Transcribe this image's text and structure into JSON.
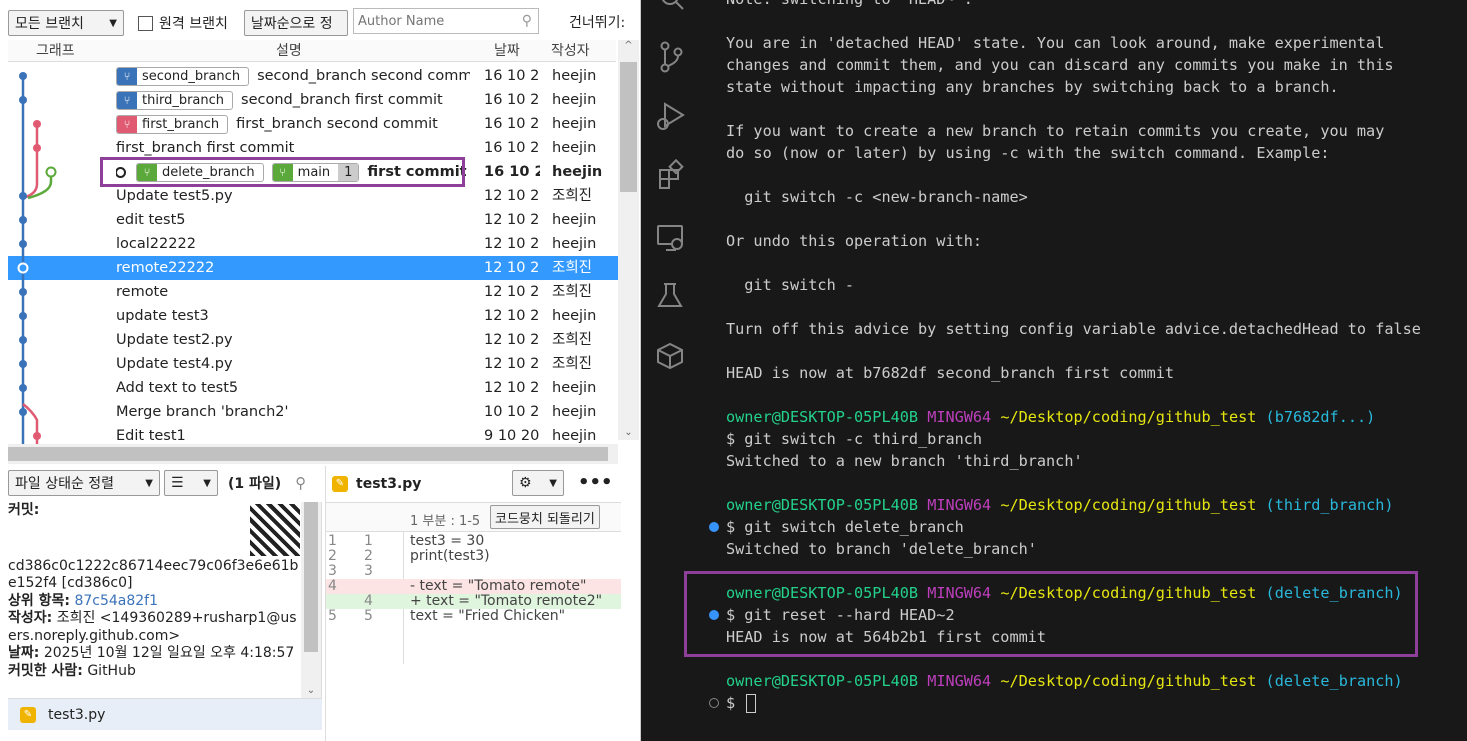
{
  "toolbar": {
    "branch_filter": "모든 브랜치",
    "remote_branch_label": "원격 브랜치",
    "sort_label": "날짜순으로 정",
    "author_placeholder": "Author Name",
    "jump_label": "건너뛰기:"
  },
  "columns": {
    "graph": "그래프",
    "description": "설명",
    "date": "날짜",
    "author": "작성자"
  },
  "commits": [
    {
      "tags": [
        "second_branch"
      ],
      "message": "second_branch second commit",
      "date": "16 10 2",
      "author": "heejin"
    },
    {
      "tags": [
        "third_branch"
      ],
      "message": "second_branch first commit",
      "date": "16 10 2",
      "author": "heejin"
    },
    {
      "tags": [
        "first_branch"
      ],
      "message": "first_branch second commit",
      "date": "16 10 2",
      "author": "heejin"
    },
    {
      "tags": [],
      "message": "first_branch first commit",
      "date": "16 10 2",
      "author": "heejin"
    },
    {
      "tags": [
        "delete_branch",
        "main"
      ],
      "badge": "1",
      "message": "first commit",
      "date": "16 10 2",
      "author": "heejin"
    },
    {
      "tags": [],
      "message": "Update test5.py",
      "date": "12 10 2",
      "author": "조희진"
    },
    {
      "tags": [],
      "message": "edit test5",
      "date": "12 10 2",
      "author": "heejin"
    },
    {
      "tags": [],
      "message": "local22222",
      "date": "12 10 2",
      "author": "heejin"
    },
    {
      "tags": [],
      "message": "remote22222",
      "date": "12 10 2",
      "author": "조희진"
    },
    {
      "tags": [],
      "message": "remote",
      "date": "12 10 2",
      "author": "조희진"
    },
    {
      "tags": [],
      "message": "update test3",
      "date": "12 10 2",
      "author": "heejin"
    },
    {
      "tags": [],
      "message": "Update test2.py",
      "date": "12 10 2",
      "author": "조희진"
    },
    {
      "tags": [],
      "message": "Update test4.py",
      "date": "12 10 2",
      "author": "조희진"
    },
    {
      "tags": [],
      "message": "Add text to test5",
      "date": "12 10 2",
      "author": "heejin"
    },
    {
      "tags": [],
      "message": "Merge branch 'branch2'",
      "date": "10 10 2",
      "author": "heejin"
    },
    {
      "tags": [],
      "message": "Edit test1",
      "date": "9 10 20",
      "author": "heejin"
    }
  ],
  "file_pane": {
    "sort_label": "파일 상태순 정렬",
    "count_label": "(1 파일)",
    "file": "test3.py"
  },
  "commit_info": {
    "commit_label": "커밋:",
    "hash": "cd386c0c1222c86714eec79c06f3e6e61be152f4 [cd386c0]",
    "parent_label": "상위 항목:",
    "parent": "87c54a82f1",
    "author_label": "작성자:",
    "author": "조희진 <149360289+rusharp1@users.noreply.github.com>",
    "date_label": "날짜:",
    "date": "2025년 10월 12일 일요일 오후 4:18:57",
    "committer_label": "커밋한 사람:",
    "committer": "GitHub"
  },
  "diff": {
    "file": "test3.py",
    "hunk_label": "1 부분 : 1-5",
    "revert_button": "코드뭉치 되돌리기",
    "lines": [
      {
        "old": "1",
        "new": "1",
        "text": "test3 = 30",
        "kind": "ctx"
      },
      {
        "old": "2",
        "new": "2",
        "text": "print(test3)",
        "kind": "ctx"
      },
      {
        "old": "3",
        "new": "3",
        "text": "",
        "kind": "ctx"
      },
      {
        "old": "4",
        "new": "",
        "text": "- text = \"Tomato remote\"",
        "kind": "del"
      },
      {
        "old": "",
        "new": "4",
        "text": "+ text = \"Tomato remote2\"",
        "kind": "add"
      },
      {
        "old": "5",
        "new": "5",
        "text": "text = \"Fried Chicken\"",
        "kind": "ctx"
      }
    ]
  },
  "terminal": {
    "lines": [
      "Note: switching to 'HEAD~'.",
      "",
      "You are in 'detached HEAD' state. You can look around, make experimental",
      "changes and commit them, and you can discard any commits you make in this",
      "state without impacting any branches by switching back to a branch.",
      "",
      "If you want to create a new branch to retain commits you create, you may",
      "do so (now or later) by using -c with the switch command. Example:",
      "",
      "  git switch -c <new-branch-name>",
      "",
      "Or undo this operation with:",
      "",
      "  git switch -",
      "",
      "Turn off this advice by setting config variable advice.detachedHead to false",
      "",
      "HEAD is now at b7682df second_branch first commit"
    ],
    "user": "owner@DESKTOP-05PL40B",
    "shell": "MINGW64",
    "path": "~/Desktop/coding/github_test",
    "prompts": [
      {
        "branch": "(b7682df...)",
        "cmd": "$ git switch -c third_branch",
        "out": "Switched to a new branch 'third_branch'"
      },
      {
        "branch": "(third_branch)",
        "cmd": "$ git switch delete_branch",
        "out": "Switched to branch 'delete_branch'"
      },
      {
        "branch": "(delete_branch)",
        "cmd": "$ git reset --hard HEAD~2",
        "out": "HEAD is now at 564b2b1 first commit"
      },
      {
        "branch": "(delete_branch)",
        "cmd": "$ ",
        "out": ""
      }
    ]
  },
  "colors": {
    "blue": "#3b73b9",
    "red": "#e05a72",
    "green": "#5ba93a",
    "highlight": "#8e3f99",
    "selection": "#3399ff"
  }
}
